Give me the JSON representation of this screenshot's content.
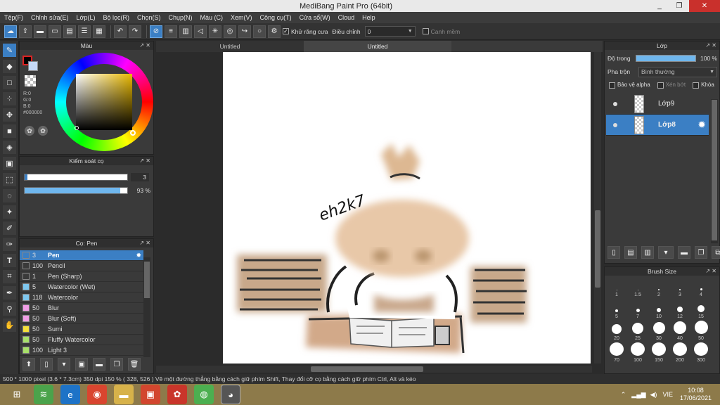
{
  "window": {
    "title": "MediBang Paint Pro (64bit)",
    "min": "_",
    "max": "❐",
    "close": "✕"
  },
  "menu": [
    "Tệp(F)",
    "Chỉnh sửa(E)",
    "Lớp(L)",
    "Bộ lọc(R)",
    "Chọn(S)",
    "Chụp(N)",
    "Màu (C)",
    "Xem(V)",
    "Công cụ(T)",
    "Cửa sổ(W)",
    "Cloud",
    "Help"
  ],
  "toolbar": {
    "antialias_label": "Khử răng cưa",
    "adjust_label": "Điều chỉnh",
    "adjust_value": "0",
    "canh_mem_label": "Canh mềm"
  },
  "color_panel": {
    "title": "Màu",
    "r": "R:0",
    "g": "G:0",
    "b": "B:0",
    "hex": "#000000"
  },
  "brush_control": {
    "title": "Kiểm soát cọ",
    "size_value": "3",
    "opacity_value": "93 %",
    "opacity_fraction": 0.93
  },
  "brush_panel": {
    "title": "Cọ: Pen",
    "items": [
      {
        "size": "3",
        "name": "Pen",
        "color": "#3a3a3a",
        "selected": true
      },
      {
        "size": "100",
        "name": "Pencil",
        "color": "#3a3a3a",
        "red": true
      },
      {
        "size": "1",
        "name": "Pen (Sharp)",
        "color": "#3a3a3a",
        "red": true
      },
      {
        "size": "5",
        "name": "Watercolor (Wet)",
        "color": "#7ec8f0",
        "red": true
      },
      {
        "size": "118",
        "name": "Watercolor",
        "color": "#7ec8f0"
      },
      {
        "size": "50",
        "name": "Blur",
        "color": "#f19ee6"
      },
      {
        "size": "50",
        "name": "Blur (Soft)",
        "color": "#f19ee6"
      },
      {
        "size": "50",
        "name": "Sumi",
        "color": "#f5e03a"
      },
      {
        "size": "50",
        "name": "Fluffy Watercolor",
        "color": "#a8e06a"
      },
      {
        "size": "100",
        "name": "Light 3",
        "color": "#a8e06a"
      }
    ]
  },
  "canvas": {
    "tabs": [
      "Untitled",
      "Untitled"
    ],
    "signature": "eh2k7"
  },
  "layer_panel": {
    "title": "Lớp",
    "opacity_label": "Độ trong",
    "opacity_value": "100 %",
    "blend_label": "Pha trộn",
    "blend_value": "Bình thường",
    "protect_alpha": "Bảo vệ alpha",
    "clipping": "Xén bớt",
    "lock": "Khóa",
    "layers": [
      {
        "name": "Lớp9",
        "selected": false
      },
      {
        "name": "Lớp8",
        "selected": true
      }
    ]
  },
  "brush_size_panel": {
    "title": "Brush Size",
    "sizes": [
      "1",
      "1.5",
      "2",
      "3",
      "4",
      "5",
      "7",
      "10",
      "12",
      "15",
      "20",
      "25",
      "30",
      "40",
      "50",
      "70",
      "100",
      "150",
      "200",
      "300"
    ]
  },
  "status": {
    "text": "500 * 1000 pixel   (3.6 * 7.3cm)   350 dpi   150 %   ( 328, 526 )   Vẽ một đường thẳng bằng cách giữ phím Shift, Thay đổi cỡ cọ bằng cách giữ phím Ctrl, Alt và kéo"
  },
  "taskbar": {
    "lang": "VIE",
    "time": "10:08",
    "date": "17/06/2021"
  }
}
